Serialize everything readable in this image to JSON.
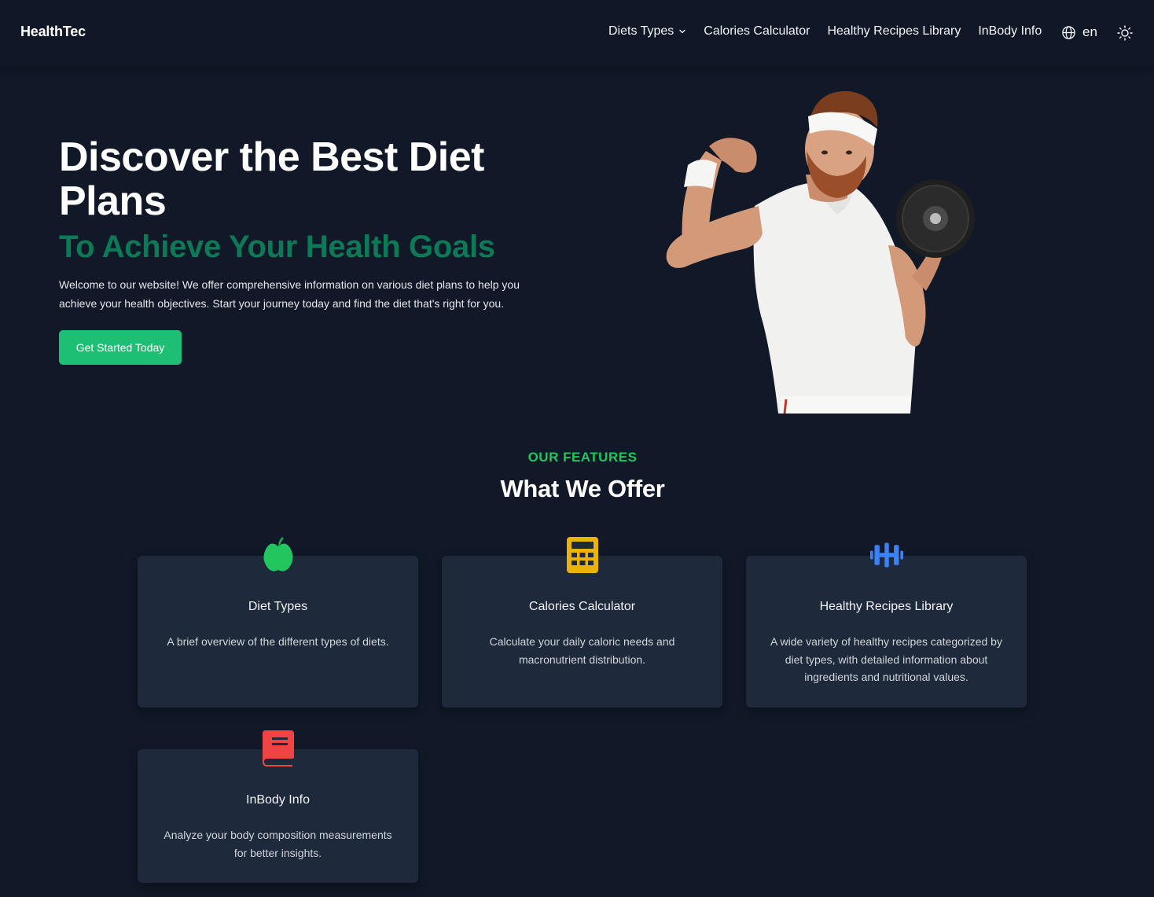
{
  "nav": {
    "brand": "HealthTec",
    "links": [
      {
        "label": "Diets Types"
      },
      {
        "label": "Calories Calculator"
      },
      {
        "label": "Healthy Recipes Library"
      },
      {
        "label": "InBody Info"
      }
    ],
    "language": "en",
    "icons": {
      "language": "globe-icon",
      "theme": "sun-icon",
      "dropdown": "chevron-down-icon"
    }
  },
  "hero": {
    "title": "Discover the Best Diet Plans",
    "subtitle": "To Achieve Your Health Goals",
    "text": "Welcome to our website! We offer comprehensive information on various diet plans to help you achieve your health objectives. Start your journey today and find the diet that's right for you.",
    "cta": "Get Started Today"
  },
  "features": {
    "eyebrow": "OUR FEATURES",
    "title": "What We Offer",
    "items": [
      {
        "title": "Diet Types",
        "desc": "A brief overview of the different types of diets.",
        "icon": "apple-icon",
        "color": "#22c55e"
      },
      {
        "title": "Calories Calculator",
        "desc": "Calculate your daily caloric needs and macronutrient distribution.",
        "icon": "calculator-icon",
        "color": "#eab308"
      },
      {
        "title": "Healthy Recipes Library",
        "desc": "A wide variety of healthy recipes categorized by diet types, with detailed information about ingredients and nutritional values.",
        "icon": "dumbbell-icon",
        "color": "#3b82f6"
      },
      {
        "title": "InBody Info",
        "desc": "Analyze your body composition measurements for better insights.",
        "icon": "book-icon",
        "color": "#ef4444"
      }
    ]
  },
  "colors": {
    "background": "#111827",
    "card": "#1e293b",
    "accent_green": "#1cbf73",
    "subtitle_green": "#0d7a57"
  }
}
